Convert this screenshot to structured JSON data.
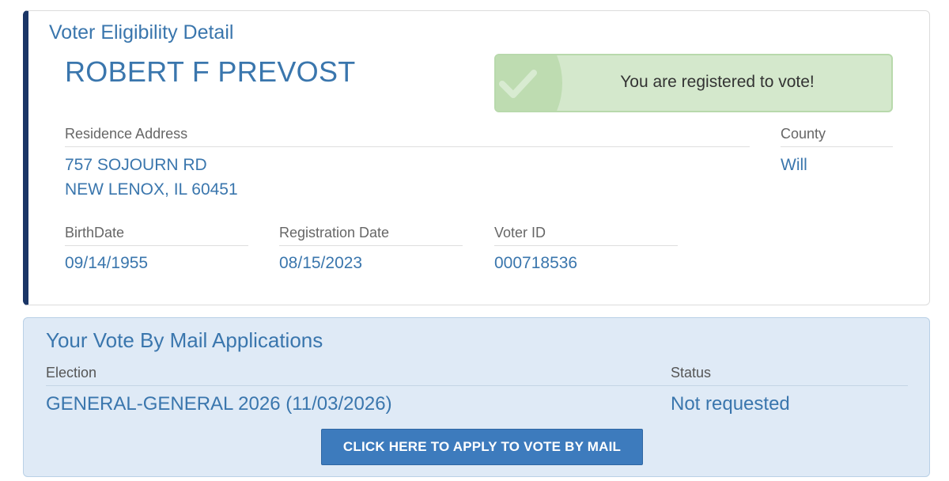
{
  "detail": {
    "title": "Voter Eligibility Detail",
    "name": "ROBERT F PREVOST",
    "status_message": "You are registered to vote!",
    "residence": {
      "label": "Residence Address",
      "line1": "757 SOJOURN RD",
      "line2": "NEW LENOX, IL 60451"
    },
    "county": {
      "label": "County",
      "value": "Will"
    },
    "birthdate": {
      "label": "BirthDate",
      "value": "09/14/1955"
    },
    "registration_date": {
      "label": "Registration Date",
      "value": "08/15/2023"
    },
    "voter_id": {
      "label": "Voter ID",
      "value": "000718536"
    }
  },
  "mail": {
    "title": "Your Vote By Mail Applications",
    "columns": {
      "election": "Election",
      "status": "Status"
    },
    "rows": [
      {
        "election": "GENERAL-GENERAL 2026 (11/03/2026)",
        "status": "Not requested"
      }
    ],
    "apply_button": "CLICK HERE TO APPLY TO VOTE BY MAIL"
  },
  "colors": {
    "accent_bar": "#1a3566",
    "link_blue": "#3a76ad",
    "success_bg": "#d4e8cc",
    "panel_bg": "#dfeaf6",
    "button_bg": "#3d7bbd"
  },
  "icons": {
    "status": "checkmark-icon"
  }
}
